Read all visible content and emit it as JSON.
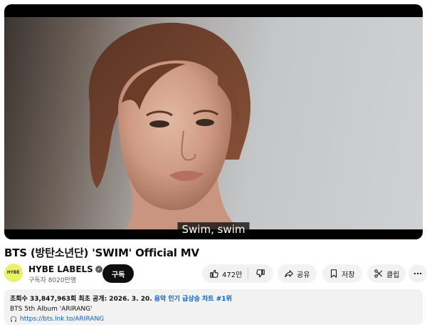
{
  "video": {
    "subtitle": "Swim, swim",
    "title": "BTS (방탄소년단) 'SWIM' Official MV"
  },
  "channel": {
    "avatar_text": "HYBE",
    "name": "HYBE LABELS",
    "subscribers": "구독자 8020만명",
    "subscribe_label": "구독"
  },
  "actions": {
    "like_count": "472만",
    "share_label": "공유",
    "save_label": "저장",
    "clip_label": "클립"
  },
  "description": {
    "stats": "조회수 33,847,963회  최초 공개: 2026. 3. 20.",
    "chart_badge": "음악 인기 급상승 차트 #1위",
    "album_line": "BTS 5th Album 'ARIRANG'",
    "link": "https://bts.lnk.to/ARIRANG"
  },
  "icons": [
    "thumbs-up-icon",
    "thumbs-down-icon",
    "share-icon",
    "save-icon",
    "scissors-icon",
    "more-icon",
    "verified-icon",
    "headphones-icon"
  ],
  "colors": {
    "subscribe_bg": "#0f0f0f",
    "pill_bg": "#f2f2f2",
    "link": "#065fd4",
    "avatar_bg": "#e8f36a"
  }
}
